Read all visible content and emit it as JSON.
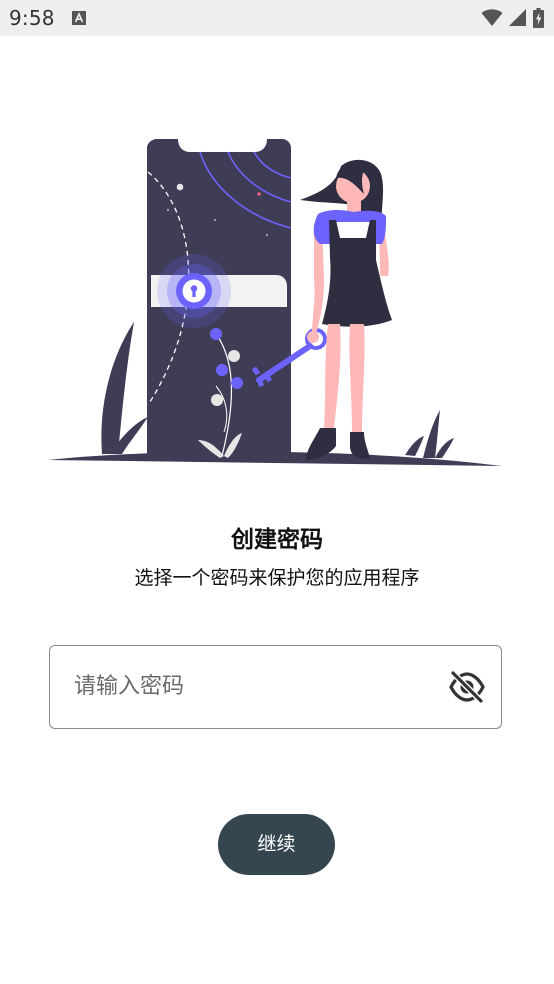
{
  "status_bar": {
    "time": "9:58"
  },
  "content": {
    "title": "创建密码",
    "subtitle": "选择一个密码来保护您的应用程序"
  },
  "password_field": {
    "placeholder": "请输入密码",
    "value": ""
  },
  "continue_button": {
    "label": "继续"
  },
  "colors": {
    "accent": "#6c63ff",
    "dark": "#3f3d56",
    "button": "#364651",
    "skin": "#ffb8b8"
  },
  "icons": {
    "visibility_toggle": "eye-off-icon",
    "illustration": "phone-lock-key-illustration"
  }
}
